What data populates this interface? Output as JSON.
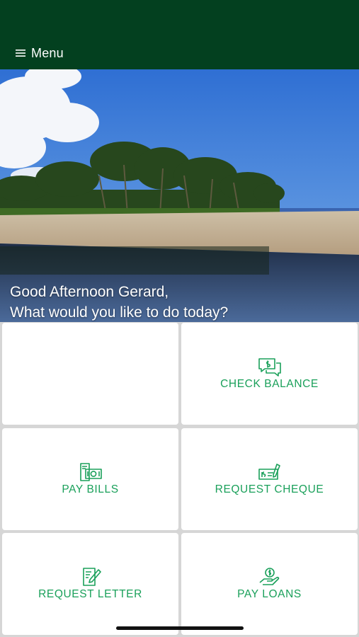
{
  "header": {
    "menu_label": "Menu",
    "menu_icon": "hamburger-icon",
    "background_color": "#03401f"
  },
  "hero": {
    "greeting_line1": "Good Afternoon Gerard,",
    "greeting_line2": "What would you like to do today?"
  },
  "tiles": [
    {
      "label": "",
      "icon": ""
    },
    {
      "label": "CHECK BALANCE",
      "icon": "chat-dollar-icon"
    },
    {
      "label": "PAY BILLS",
      "icon": "bill-cash-icon"
    },
    {
      "label": "REQUEST CHEQUE",
      "icon": "cheque-pen-icon"
    },
    {
      "label": "REQUEST LETTER",
      "icon": "document-pen-icon"
    },
    {
      "label": "PAY LOANS",
      "icon": "hand-coin-icon"
    }
  ],
  "colors": {
    "accent_green": "#1aa05a",
    "tile_background": "#ffffff",
    "grid_gap": "#d6d6d6"
  }
}
